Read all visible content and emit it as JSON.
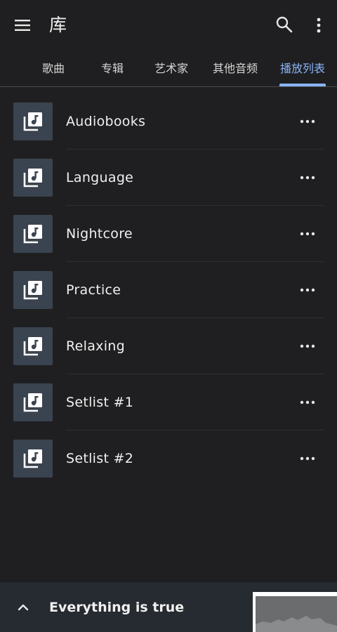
{
  "header": {
    "title": "库",
    "menu_icon": "menu-icon",
    "search_icon": "search-icon",
    "more_icon": "more-vert-icon"
  },
  "tabs": [
    {
      "label": "歌曲",
      "active": false
    },
    {
      "label": "专辑",
      "active": false
    },
    {
      "label": "艺术家",
      "active": false
    },
    {
      "label": "其他音频",
      "active": false
    },
    {
      "label": "播放列表",
      "active": true
    }
  ],
  "playlists": [
    {
      "name": "Audiobooks",
      "icon": "playlist-music-icon"
    },
    {
      "name": "Language",
      "icon": "playlist-music-icon"
    },
    {
      "name": "Nightcore",
      "icon": "playlist-music-icon"
    },
    {
      "name": "Practice",
      "icon": "playlist-music-icon"
    },
    {
      "name": "Relaxing",
      "icon": "playlist-music-icon"
    },
    {
      "name": "Setlist #1",
      "icon": "playlist-music-icon"
    },
    {
      "name": "Setlist #2",
      "icon": "playlist-music-icon"
    }
  ],
  "miniplayer": {
    "title": "Everything is true",
    "expand_icon": "chevron-up-icon"
  },
  "colors": {
    "background": "#1f1f21",
    "accent": "#8ab4f8",
    "thumb": "#3a4450",
    "miniplayer": "#262a31"
  }
}
